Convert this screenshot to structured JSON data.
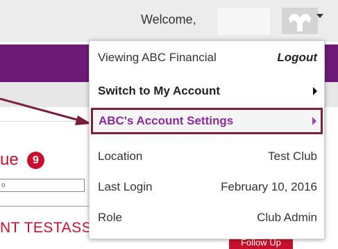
{
  "header": {
    "welcome_text": "Welcome,",
    "avatar_icon": "muscle-arm-icon"
  },
  "background": {
    "issue_label": "ue",
    "issue_count": "9",
    "small_input_value": "o",
    "list_text": "NT TESTASS",
    "red_button_label": "Follow Up"
  },
  "menu": {
    "viewing": "Viewing ABC Financial",
    "logout": "Logout",
    "switch": "Switch to My Account",
    "settings": "ABC's Account Settings",
    "location_label": "Location",
    "location_value": "Test Club",
    "last_login_label": "Last Login",
    "last_login_value": "February 10, 2016",
    "role_label": "Role",
    "role_value": "Club Admin"
  },
  "colors": {
    "brand_purple": "#6d1a76",
    "alert_red": "#c8102e",
    "highlight_border": "#7b1f3a",
    "settings_text": "#8a2a9e"
  }
}
